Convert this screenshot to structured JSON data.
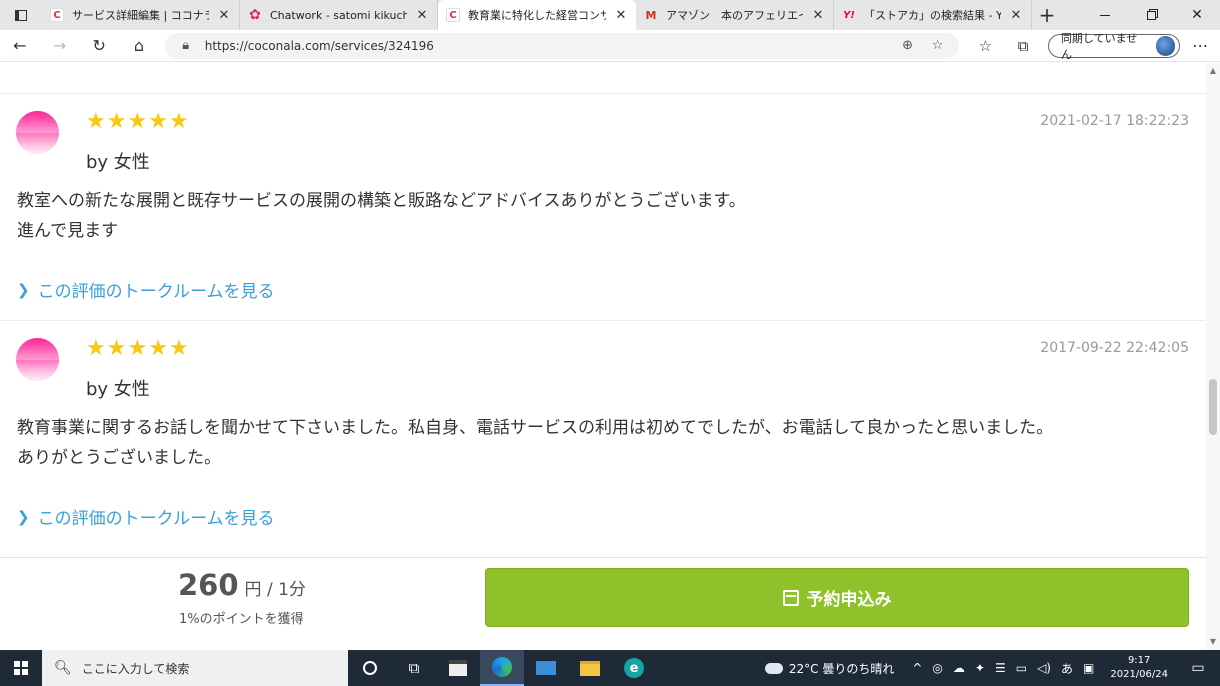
{
  "browser": {
    "tabs": [
      {
        "favicon": "C",
        "title": "サービス詳細編集 | ココナラ"
      },
      {
        "favicon": "✿",
        "title": "Chatwork - satomi kikuchi"
      },
      {
        "favicon": "C",
        "title": "教育業に特化した経営コンサルテ"
      },
      {
        "favicon": "M",
        "title": "アマゾン　本のアフェリエイト - em"
      },
      {
        "favicon": "Y!",
        "title": "「ストアカ」の検索結果 - Yahoo!"
      }
    ],
    "tab_close_glyph": "✕",
    "new_tab_glyph": "+",
    "url": "https://coconala.com/services/324196",
    "sync_label": "同期していません"
  },
  "reviews": [
    {
      "date": "2021-02-17 18:22:23",
      "reviewer": "by 女性",
      "stars": 5,
      "lines": [
        "教室への新たな展開と既存サービスの展開の構築と販路などアドバイスありがとうございます。",
        "進んで見ます"
      ],
      "link": "この評価のトークルームを見る"
    },
    {
      "date": "2017-09-22 22:42:05",
      "reviewer": "by 女性",
      "stars": 5,
      "lines": [
        "教育事業に関するお話しを聞かせて下さいました。私自身、電話サービスの利用は初めてでしたが、お電話して良かったと思いました。",
        "ありがとうございました。"
      ],
      "link": "この評価のトークルームを見る"
    }
  ],
  "booking": {
    "price": "260",
    "unit": "円 / 1分",
    "points": "1%のポイントを獲得",
    "button": "予約申込み"
  },
  "taskbar": {
    "search_placeholder": "ここに入力して検索",
    "weather": "22°C  曇りのち晴れ",
    "ime": "あ",
    "time": "9:17",
    "date": "2021/06/24"
  },
  "colors": {
    "star": "#f7c913",
    "link": "#3aa0d8",
    "button": "#8ec12a",
    "taskbar": "#1f2a38"
  }
}
